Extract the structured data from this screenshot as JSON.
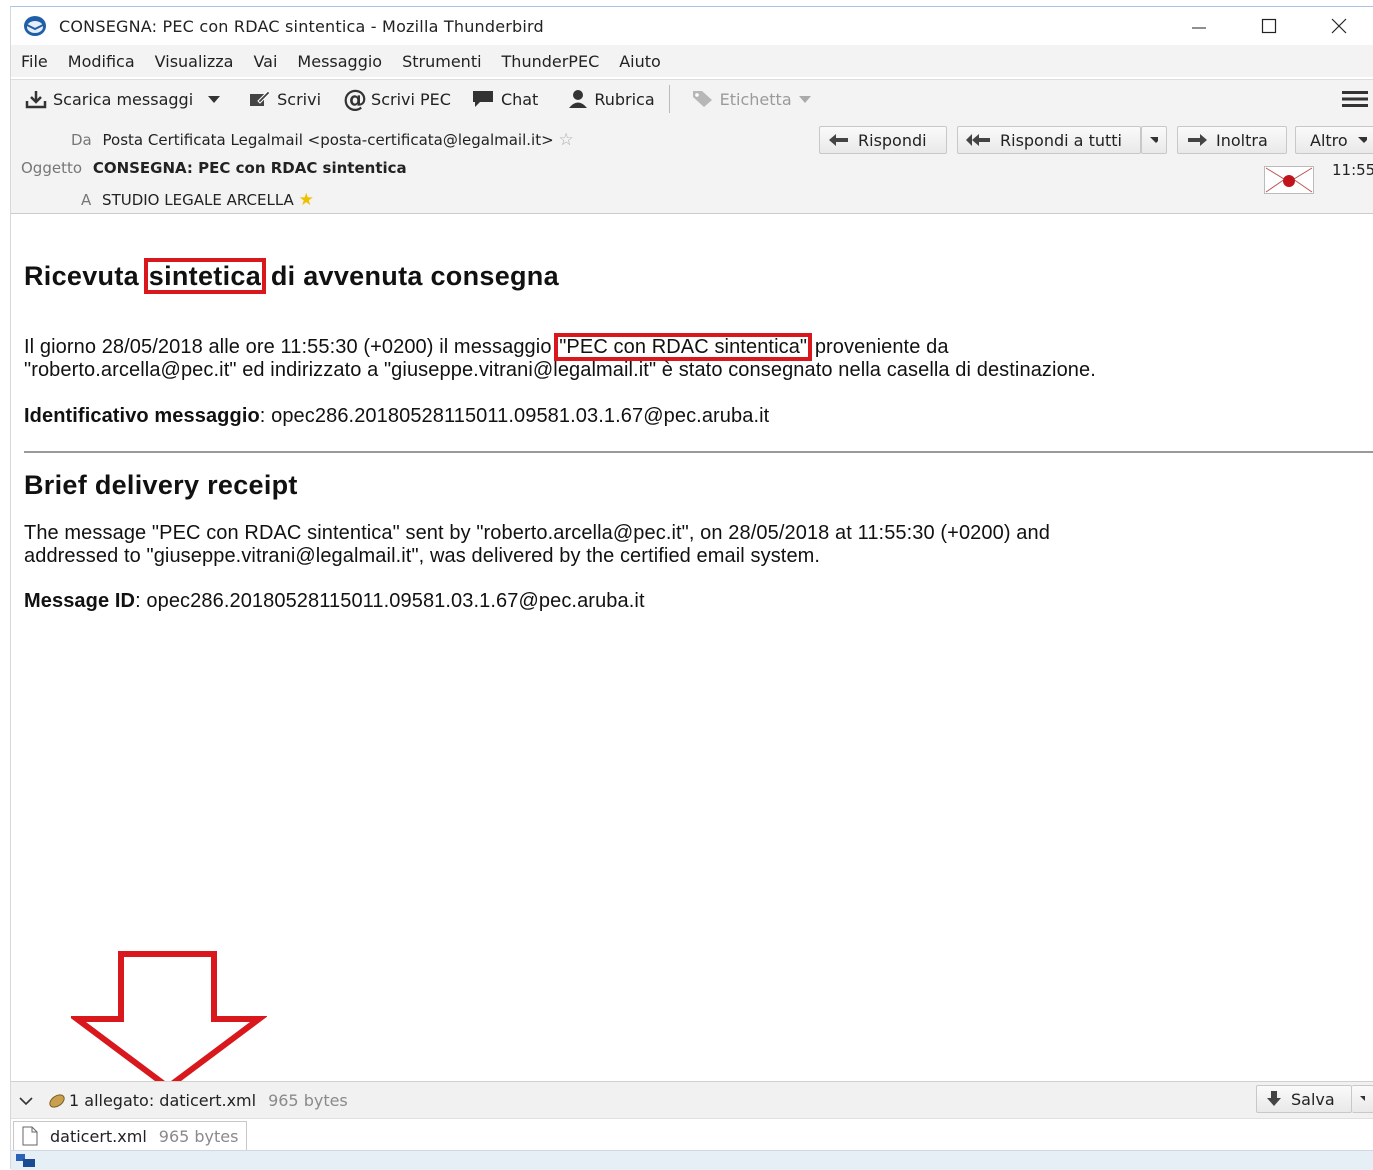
{
  "window": {
    "title": "CONSEGNA: PEC con RDAC sintentica - Mozilla Thunderbird"
  },
  "menu": [
    "File",
    "Modifica",
    "Visualizza",
    "Vai",
    "Messaggio",
    "Strumenti",
    "ThunderPEC",
    "Aiuto"
  ],
  "toolbar": {
    "get_messages": "Scarica messaggi",
    "write": "Scrivi",
    "write_pec": "Scrivi PEC",
    "chat": "Chat",
    "address_book": "Rubrica",
    "tag": "Etichetta"
  },
  "header": {
    "from_label": "Da",
    "from_value": "Posta Certificata Legalmail <posta-certificata@legalmail.it>",
    "subject_label": "Oggetto",
    "subject_value": "CONSEGNA: PEC con RDAC sintentica",
    "to_label": "A",
    "to_value": "STUDIO LEGALE ARCELLA",
    "time": "11:55",
    "reply": "Rispondi",
    "reply_all": "Rispondi a tutti",
    "forward": "Inoltra",
    "more": "Altro"
  },
  "body": {
    "it_title_a": "Ricevuta",
    "it_title_b": "sintetica",
    "it_title_c": "di avvenuta consegna",
    "it_line1_a": "Il giorno 28/05/2018 alle ore 11:55:30 (+0200) il messaggio",
    "it_line1_b": "\"PEC con RDAC sintentica\"",
    "it_line1_c": "proveniente da",
    "it_line2": "\"roberto.arcella@pec.it\" ed indirizzato a \"giuseppe.vitrani@legalmail.it\" è stato consegnato nella casella di destinazione.",
    "it_id_label": "Identificativo messaggio",
    "it_id_value": ": opec286.20180528115011.09581.03.1.67@pec.aruba.it",
    "en_title": "Brief delivery receipt",
    "en_line1": "The message \"PEC con RDAC sintentica\" sent by \"roberto.arcella@pec.it\", on 28/05/2018 at 11:55:30 (+0200) and",
    "en_line2": "addressed to \"giuseppe.vitrani@legalmail.it\", was delivered by the certified email system.",
    "en_id_label": "Message ID",
    "en_id_value": ": opec286.20180528115011.09581.03.1.67@pec.aruba.it"
  },
  "attachments": {
    "summary": "1 allegato: daticert.xml",
    "summary_size": "965 bytes",
    "save": "Salva",
    "file_name": "daticert.xml",
    "file_size": "965 bytes"
  },
  "colors": {
    "highlight": "#d8181c",
    "chrome": "#f3f3f3"
  }
}
